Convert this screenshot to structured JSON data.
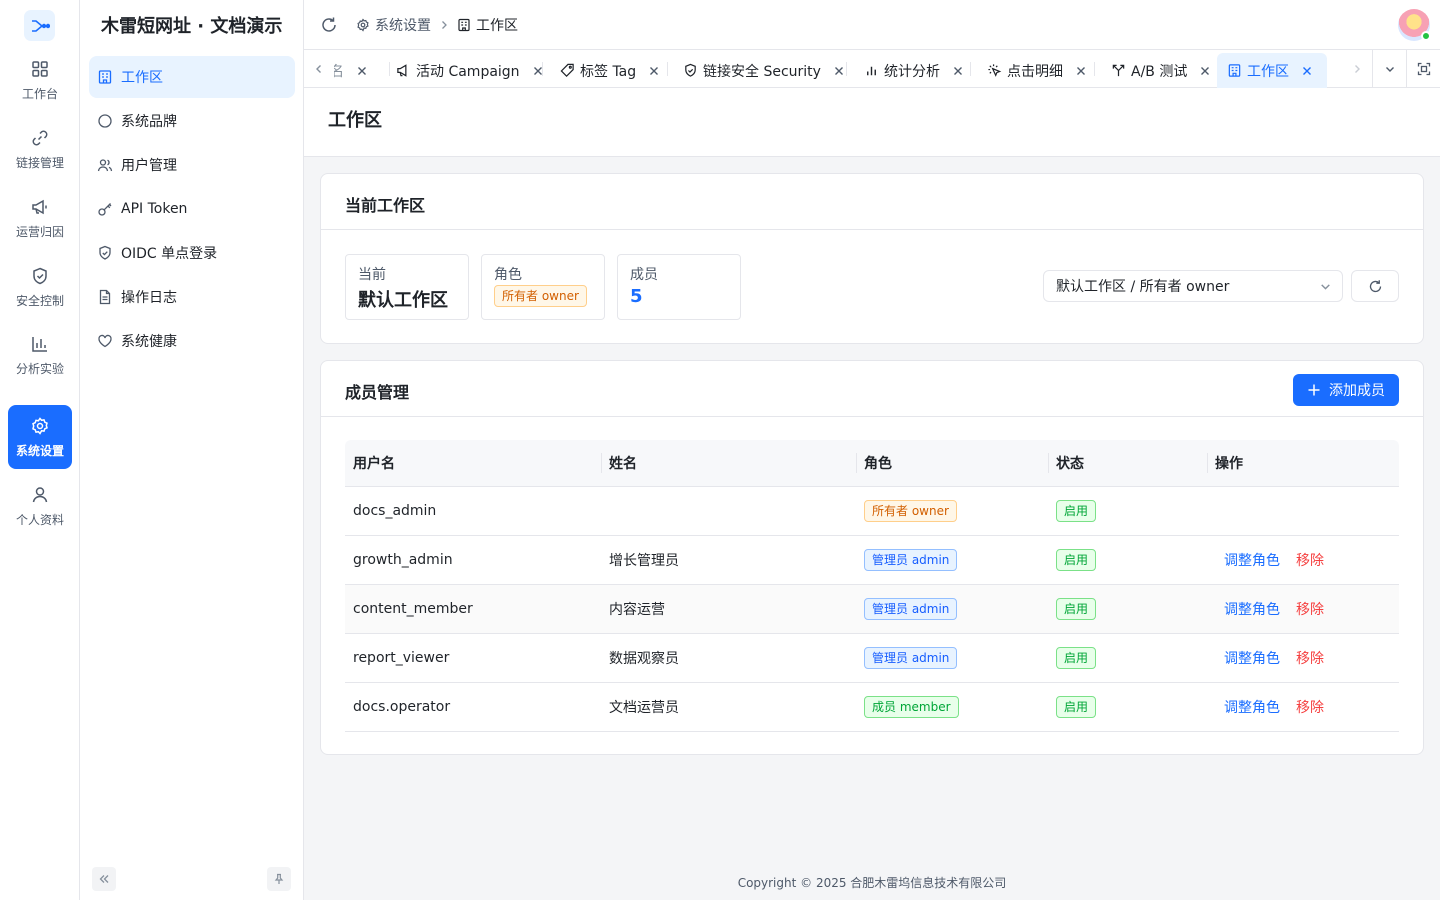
{
  "rail": {
    "items": [
      {
        "label": "工作台",
        "icon": "dashboard-icon"
      },
      {
        "label": "链接管理",
        "icon": "link-icon"
      },
      {
        "label": "运营归因",
        "icon": "megaphone-icon"
      },
      {
        "label": "安全控制",
        "icon": "shield-icon"
      },
      {
        "label": "分析实验",
        "icon": "bar-chart-icon"
      },
      {
        "label": "系统设置",
        "icon": "gear-icon",
        "active": true
      },
      {
        "label": "个人资料",
        "icon": "user-icon"
      }
    ]
  },
  "submenu": {
    "title": "木雷短网址 · 文档演示",
    "items": [
      {
        "label": "工作区",
        "icon": "building-icon",
        "active": true
      },
      {
        "label": "系统品牌",
        "icon": "circle-icon"
      },
      {
        "label": "用户管理",
        "icon": "users-icon"
      },
      {
        "label": "API Token",
        "icon": "key-icon"
      },
      {
        "label": "OIDC 单点登录",
        "icon": "shield-check-icon"
      },
      {
        "label": "操作日志",
        "icon": "file-text-icon"
      },
      {
        "label": "系统健康",
        "icon": "heart-icon"
      }
    ]
  },
  "breadcrumb": {
    "parent": "系统设置",
    "current": "工作区"
  },
  "tabs": [
    {
      "label": "名",
      "icon": ""
    },
    {
      "label": "活动 Campaign",
      "icon": "megaphone-icon"
    },
    {
      "label": "标签 Tag",
      "icon": "tag-icon"
    },
    {
      "label": "链接安全 Security",
      "icon": "shield-check-icon"
    },
    {
      "label": "统计分析",
      "icon": "bar-chart-icon"
    },
    {
      "label": "点击明细",
      "icon": "click-icon"
    },
    {
      "label": "A/B 测试",
      "icon": "split-icon"
    },
    {
      "label": "工作区",
      "icon": "building-icon",
      "active": true
    }
  ],
  "page": {
    "title": "工作区"
  },
  "current_workspace": {
    "heading": "当前工作区",
    "current_label": "当前",
    "current_value": "默认工作区",
    "role_label": "角色",
    "role_value": "所有者 owner",
    "members_label": "成员",
    "members_value": "5",
    "select_value": "默认工作区 / 所有者 owner"
  },
  "members": {
    "heading": "成员管理",
    "add_button": "添加成员",
    "columns": [
      "用户名",
      "姓名",
      "角色",
      "状态",
      "操作"
    ],
    "rows": [
      {
        "username": "docs_admin",
        "name": "",
        "role": "所有者 owner",
        "role_color": "orange",
        "status": "启用",
        "actions": []
      },
      {
        "username": "growth_admin",
        "name": "增长管理员",
        "role": "管理员 admin",
        "role_color": "blue",
        "status": "启用",
        "actions": [
          "调整角色",
          "移除"
        ]
      },
      {
        "username": "content_member",
        "name": "内容运营",
        "role": "管理员 admin",
        "role_color": "blue",
        "status": "启用",
        "actions": [
          "调整角色",
          "移除"
        ]
      },
      {
        "username": "report_viewer",
        "name": "数据观察员",
        "role": "管理员 admin",
        "role_color": "blue",
        "status": "启用",
        "actions": [
          "调整角色",
          "移除"
        ]
      },
      {
        "username": "docs.operator",
        "name": "文档运营员",
        "role": "成员 member",
        "role_color": "green",
        "status": "启用",
        "actions": [
          "调整角色",
          "移除"
        ]
      }
    ]
  },
  "footer": {
    "copyright": "Copyright © 2025 合肥木雷坞信息技术有限公司"
  },
  "colors": {
    "primary": "#1a6dff",
    "danger": "#f53f3f",
    "owner_tag": "#d25f00",
    "admin_tag": "#165dff",
    "member_tag": "#00a637"
  }
}
